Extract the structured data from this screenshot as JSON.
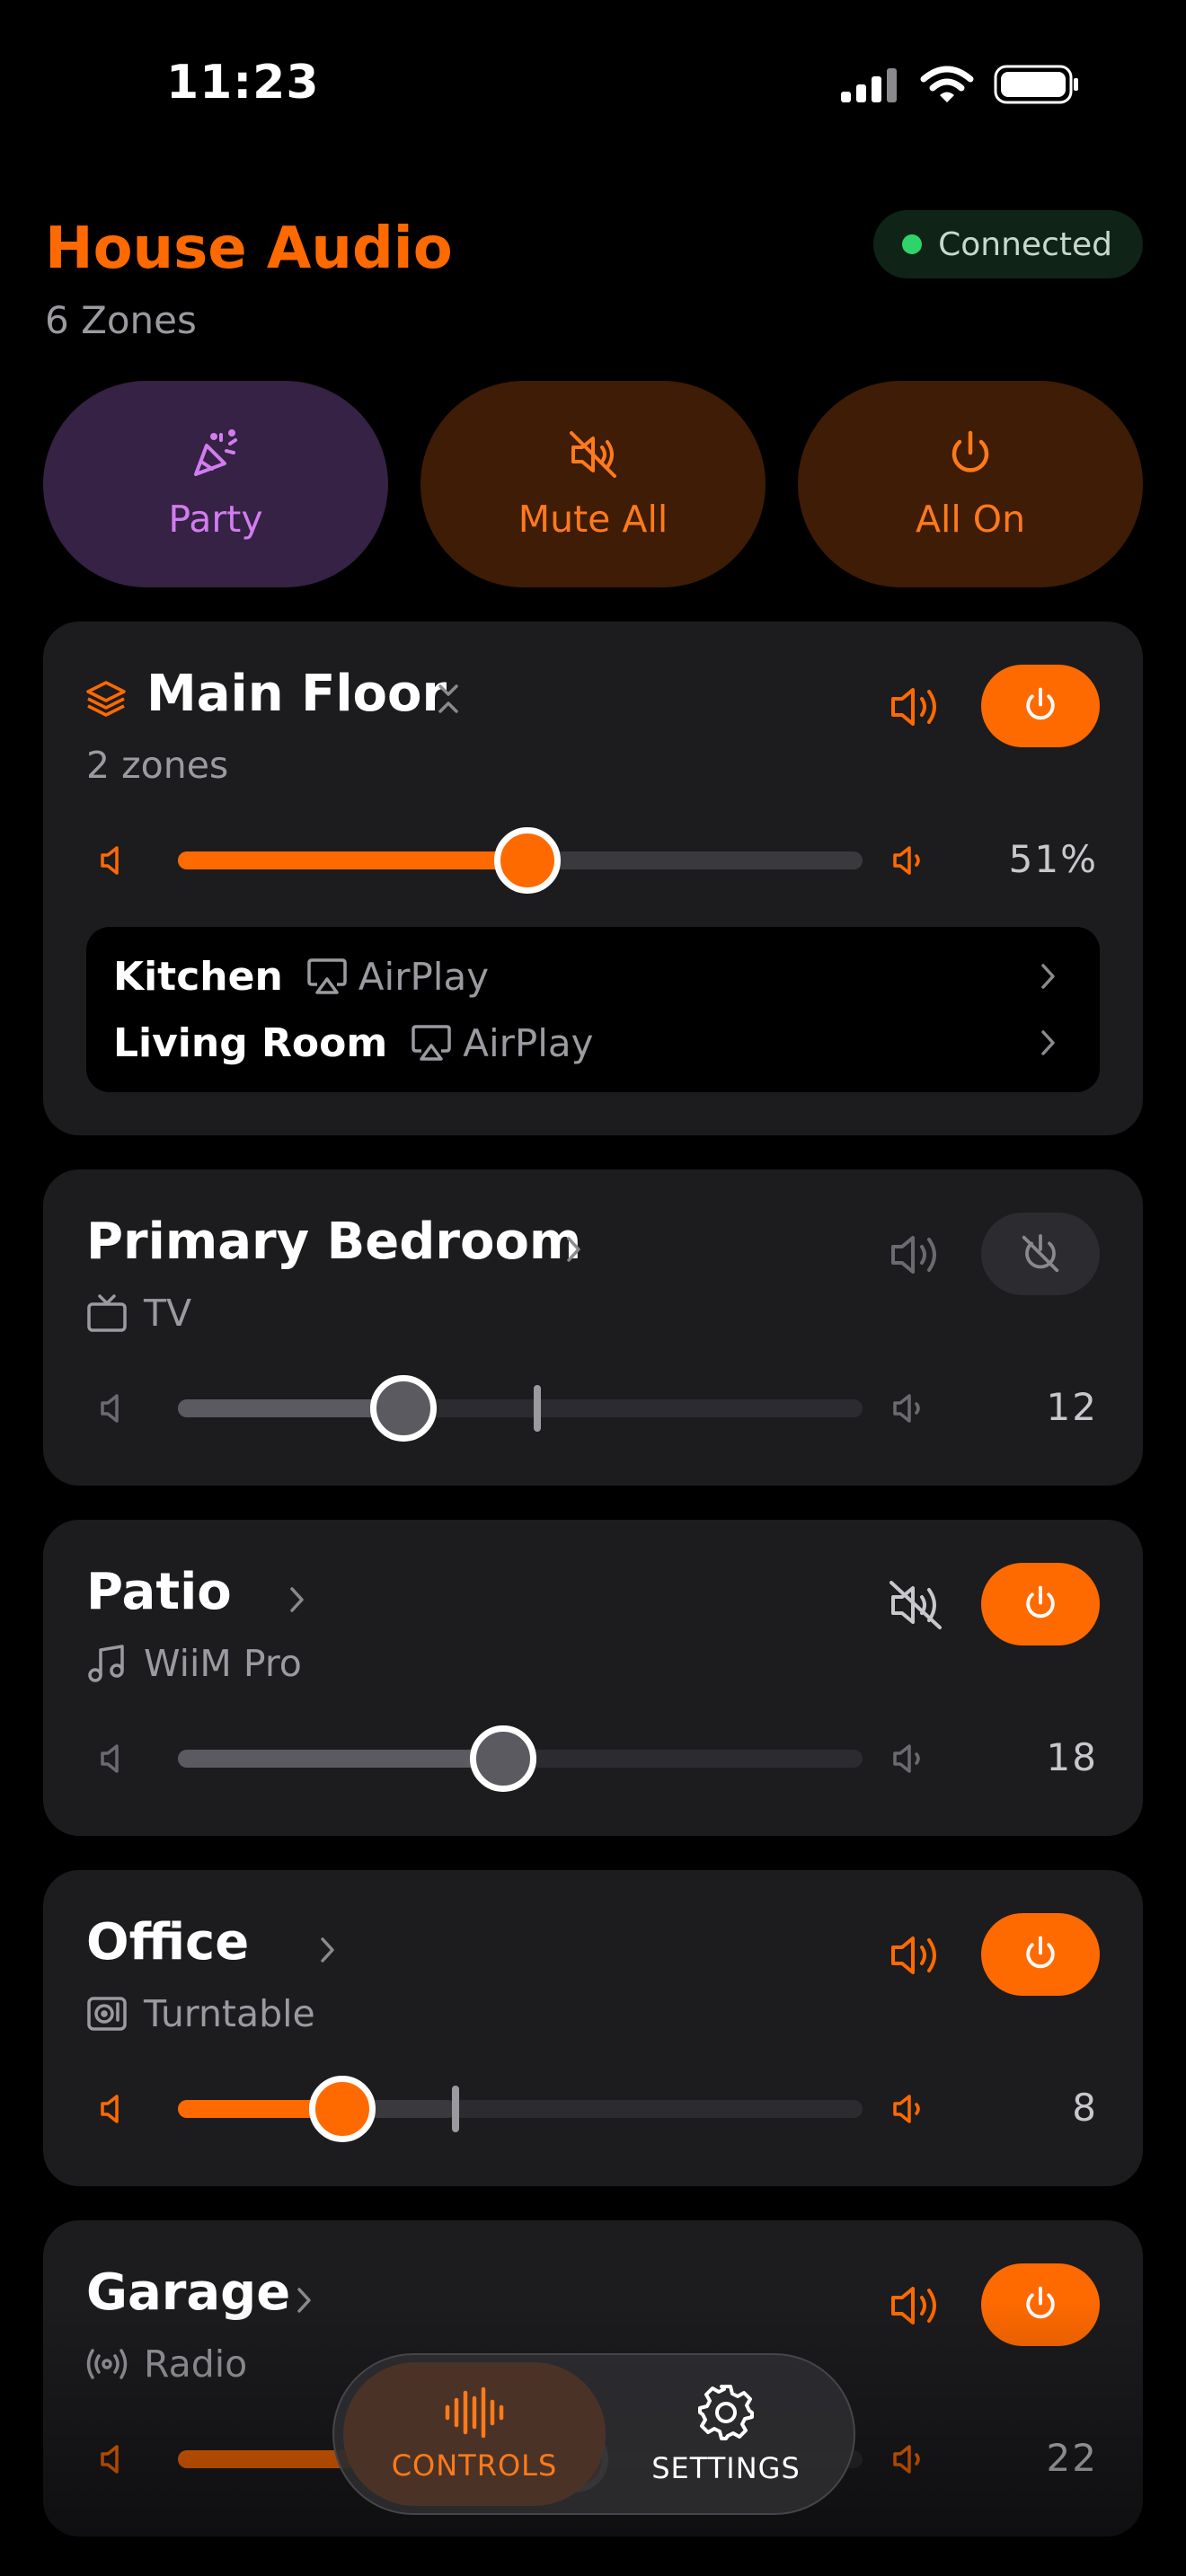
{
  "status_bar": {
    "time": "11:23"
  },
  "header": {
    "title": "House Audio",
    "subtitle": "6 Zones",
    "connection_status": "Connected",
    "connection_color": "#2ed46a"
  },
  "quick_actions": [
    {
      "label": "Party",
      "icon": "party-popper-icon"
    },
    {
      "label": "Mute All",
      "icon": "speaker-muted-icon"
    },
    {
      "label": "All On",
      "icon": "power-icon"
    }
  ],
  "groups": [
    {
      "name": "Main Floor",
      "subtitle": "2 zones",
      "volume_percent": 51,
      "volume_label": "51%",
      "powered": true,
      "zones": [
        {
          "name": "Kitchen",
          "source": "AirPlay",
          "source_icon": "airplay-icon"
        },
        {
          "name": "Living Room",
          "source": "AirPlay",
          "source_icon": "airplay-icon"
        }
      ]
    }
  ],
  "zones": [
    {
      "name": "Primary Bedroom",
      "source": "TV",
      "source_icon": "tv-icon",
      "volume": 12,
      "volume_fraction": 0.33,
      "marker_fraction": 0.525,
      "powered": false,
      "muted": false
    },
    {
      "name": "Patio",
      "source": "WiiM Pro",
      "source_icon": "music-note-icon",
      "volume": 18,
      "volume_fraction": 0.475,
      "powered": true,
      "muted": true
    },
    {
      "name": "Office",
      "source": "Turntable",
      "source_icon": "turntable-icon",
      "volume": 8,
      "volume_fraction": 0.24,
      "marker_fraction": 0.405,
      "powered": true,
      "muted": false
    },
    {
      "name": "Garage",
      "source": "Radio",
      "source_icon": "radio-icon",
      "volume": 22,
      "volume_fraction": 0.58,
      "powered": true,
      "muted": false
    }
  ],
  "nav": [
    {
      "label": "CONTROLS",
      "icon": "waveform-icon",
      "active": true
    },
    {
      "label": "SETTINGS",
      "icon": "gear-icon",
      "active": false
    }
  ],
  "colors": {
    "accent": "#ff6a00",
    "card": "#1c1c1f",
    "party": "#d27cf0",
    "muted_text": "#9a9aa0"
  }
}
